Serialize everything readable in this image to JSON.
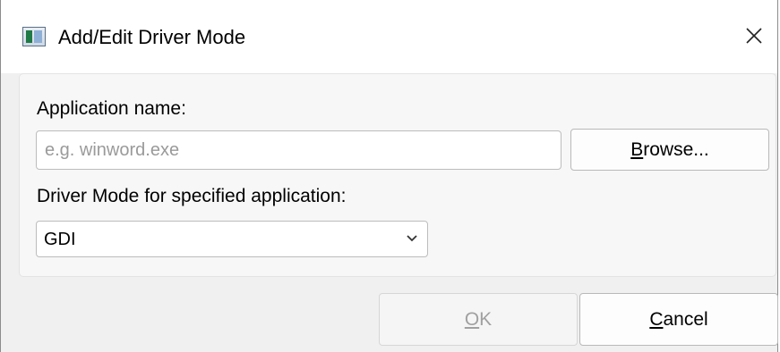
{
  "window": {
    "title": "Add/Edit Driver Mode",
    "app_icon": "app-window-icon",
    "close_icon": "close-icon"
  },
  "form": {
    "app_name_label": "Application name:",
    "app_name_value": "",
    "app_name_placeholder": "e.g. winword.exe",
    "browse_mnemonic": "B",
    "browse_rest": "rowse...",
    "mode_label": "Driver Mode for specified application:",
    "mode_selected": "GDI",
    "mode_dropdown_icon": "chevron-down-icon"
  },
  "footer": {
    "ok_mnemonic": "O",
    "ok_rest": "K",
    "ok_enabled": false,
    "cancel_mnemonic": "C",
    "cancel_rest": "ancel"
  }
}
